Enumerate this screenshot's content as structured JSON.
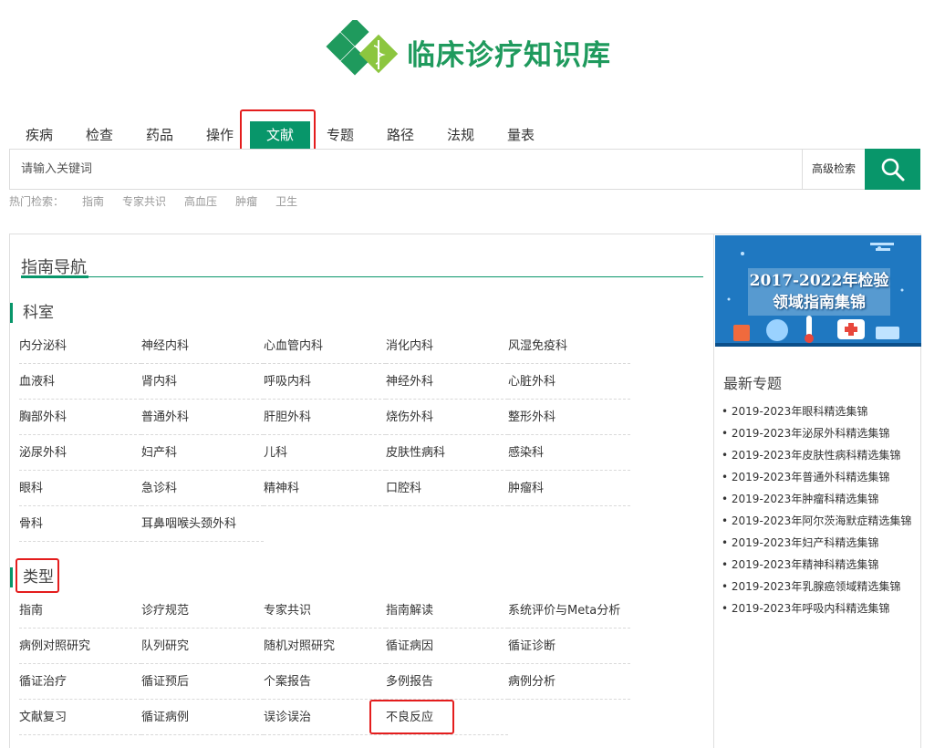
{
  "brand": {
    "title": "临床诊疗知识库"
  },
  "nav": {
    "items": [
      "疾病",
      "检查",
      "药品",
      "操作",
      "文献",
      "专题",
      "路径",
      "法规",
      "量表"
    ],
    "active_index": 4
  },
  "search": {
    "placeholder": "请输入关键词",
    "advanced_label": "高级检索"
  },
  "hot": {
    "label": "热门检索：",
    "items": [
      "指南",
      "专家共识",
      "高血压",
      "肿瘤",
      "卫生"
    ]
  },
  "guide": {
    "title": "指南导航",
    "departments": {
      "title": "科室",
      "items": [
        "内分泌科",
        "神经内科",
        "心血管内科",
        "消化内科",
        "风湿免疫科",
        "血液科",
        "肾内科",
        "呼吸内科",
        "神经外科",
        "心脏外科",
        "胸部外科",
        "普通外科",
        "肝胆外科",
        "烧伤外科",
        "整形外科",
        "泌尿外科",
        "妇产科",
        "儿科",
        "皮肤性病科",
        "感染科",
        "眼科",
        "急诊科",
        "精神科",
        "口腔科",
        "肿瘤科",
        "骨科",
        "耳鼻咽喉头颈外科"
      ]
    },
    "types": {
      "title": "类型",
      "items": [
        "指南",
        "诊疗规范",
        "专家共识",
        "指南解读",
        "系统评价与Meta分析",
        "病例对照研究",
        "队列研究",
        "随机对照研究",
        "循证病因",
        "循证诊断",
        "循证治疗",
        "循证预后",
        "个案报告",
        "多例报告",
        "病例分析",
        "文献复习",
        "循证病例",
        "误诊误治",
        "不良反应"
      ]
    }
  },
  "sidebar": {
    "banner_line1": "2017-2022年检验",
    "banner_line2": "领域指南集锦",
    "latest_title": "最新专题",
    "latest": [
      "2019-2023年眼科精选集锦",
      "2019-2023年泌尿外科精选集锦",
      "2019-2023年皮肤性病科精选集锦",
      "2019-2023年普通外科精选集锦",
      "2019-2023年肿瘤科精选集锦",
      "2019-2023年阿尔茨海默症精选集锦",
      "2019-2023年妇产科精选集锦",
      "2019-2023年精神科精选集锦",
      "2019-2023年乳腺癌领域精选集锦",
      "2019-2023年呼吸内科精选集锦"
    ]
  },
  "colors": {
    "brand_green": "#08966a",
    "highlight_red": "#e41d1d"
  }
}
